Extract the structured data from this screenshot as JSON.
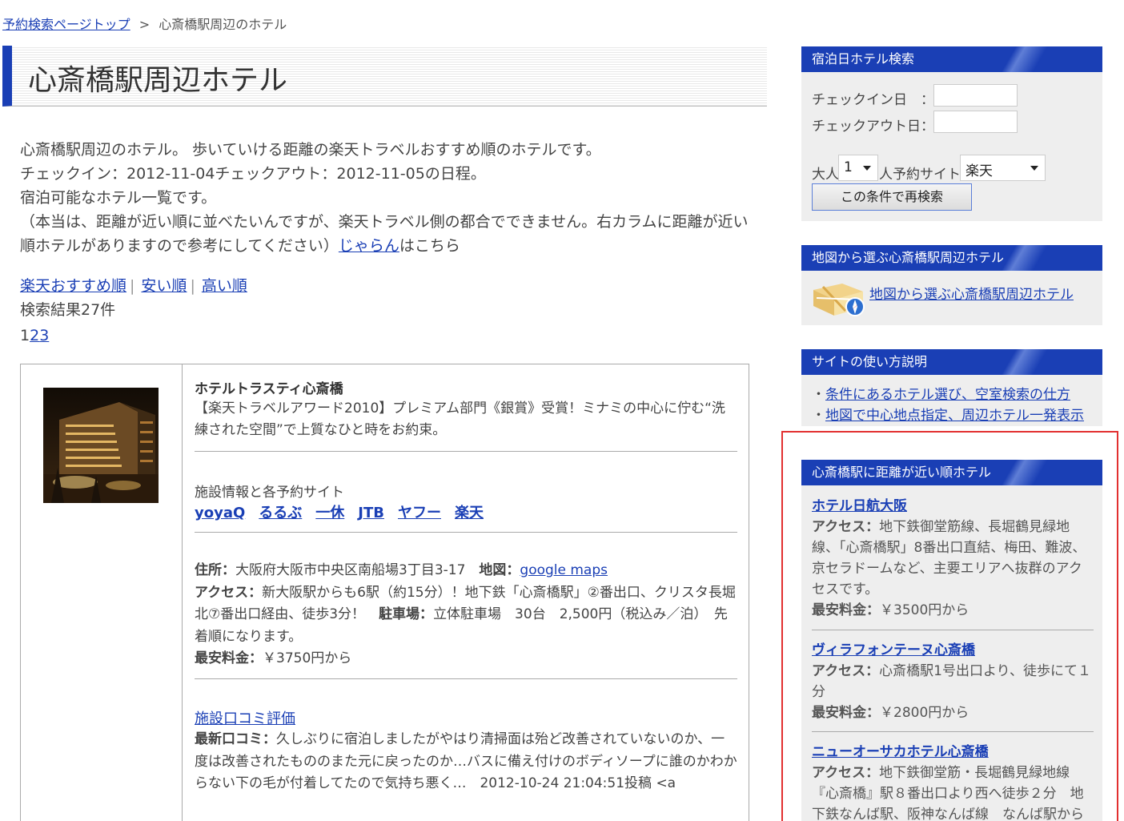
{
  "breadcrumb": {
    "home_label": "予約検索ページトップ",
    "separator": ">",
    "current": "心斎橋駅周辺のホテル"
  },
  "page_title": "心斎橋駅周辺ホテル",
  "intro": {
    "line1": "心斎橋駅周辺のホテル。 歩いていける距離の楽天トラベルおすすめ順のホテルです。",
    "line2": "チェックイン：2012-11-04チェックアウト：2012-11-05の日程。",
    "line3": "宿泊可能なホテル一覧です。",
    "line4": "（本当は、距離が近い順に並べたいんですが、楽天トラベル側の都合でできません。右カラムに距離が近い順ホテルがありますので参考にしてください）",
    "jalan_link": "じゃらん",
    "jalan_suffix": "はこちら"
  },
  "sort": {
    "recommended": "楽天おすすめ順",
    "cheap": "安い順",
    "expensive": "高い順",
    "separator": "|"
  },
  "result_count": "検索結果27件",
  "pager": {
    "current": "1",
    "page2": "2",
    "page3": "3"
  },
  "hotel": {
    "name": "ホテルトラスティ心斎橋",
    "description": "【楽天トラベルアワード2010】プレミアム部門《銀賞》受賞！ミナミの中心に佇む“洗練された空間”で上質なひと時をお約束。",
    "sites_label": "施設情報と各予約サイト",
    "sites": [
      "yoyaQ",
      "るるぶ",
      "一休",
      "JTB",
      "ヤフー",
      "楽天"
    ],
    "address_label": "住所：",
    "address": "大阪府大阪市中央区南船場3丁目3-17",
    "map_label": "地図：",
    "map_link": "google maps",
    "access_label": "アクセス：",
    "access": "新大阪駅からも6駅（約15分）！地下鉄「心斎橋駅」②番出口、クリスタ長堀 北⑦番出口経由、徒歩3分！",
    "parking_label": "駐車場：",
    "parking": "立体駐車場　30台　2,500円（税込み／泊）　先着順になります。",
    "price_label": "最安料金：",
    "price": "￥3750円から",
    "review_title": "施設口コミ評価",
    "review_label": "最新口コミ：",
    "review": "久しぶりに宿泊しましたがやはり清掃面は殆ど改善されていないのか、一度は改善されたもののまた元に戻ったのか…バスに備え付けのボディソープに誰のかわからない下の毛が付着してたので気持ち悪く…　2012-10-24 21:04:51投稿 <a"
  },
  "sidebar": {
    "search": {
      "title": "宿泊日ホテル検索",
      "checkin_label": "チェックイン日　：",
      "checkout_label": "チェックアウト日：",
      "checkin_value": "",
      "checkout_value": "",
      "adults_label": "大人",
      "adults_value": "1",
      "people_label": "人",
      "site_label": "予約サイト",
      "site_value": "楽天",
      "button": "この条件で再検索"
    },
    "map": {
      "title": "地図から選ぶ心斎橋駅周辺ホテル",
      "link": "地図から選ぶ心斎橋駅周辺ホテル"
    },
    "howto": {
      "title": "サイトの使い方説明",
      "bullet": "・",
      "item1": "条件にあるホテル選び、空室検索の仕方",
      "item2": "地図で中心地点指定、周辺ホテル一発表示"
    },
    "near": {
      "title": "心斎橋駅に距離が近い順ホテル",
      "access_label": "アクセス：",
      "price_label": "最安料金：",
      "items": [
        {
          "name": "ホテル日航大阪",
          "access": "地下鉄御堂筋線、長堀鶴見緑地線、「心斎橋駅」8番出口直結、梅田、難波、京セラドームなど、主要エリアへ抜群のアクセスです。",
          "price": "￥3500円から"
        },
        {
          "name": "ヴィラフォンテーヌ心斎橋",
          "access": "心斎橋駅1号出口より、徒歩にて１分",
          "price": "￥2800円から"
        },
        {
          "name": "ニューオーサカホテル心斎橋",
          "access": "地下鉄御堂筋・長堀鶴見緑地線『心斎橋』駅８番出口より西へ徒歩２分　地下鉄なんば駅、阪神なんば線　なんば駅から"
        }
      ]
    }
  },
  "colors": {
    "accent": "#1a3fb5",
    "link": "#1a3fb5",
    "highlight": "#e23030",
    "sidebar_bg": "#eeeeee"
  }
}
